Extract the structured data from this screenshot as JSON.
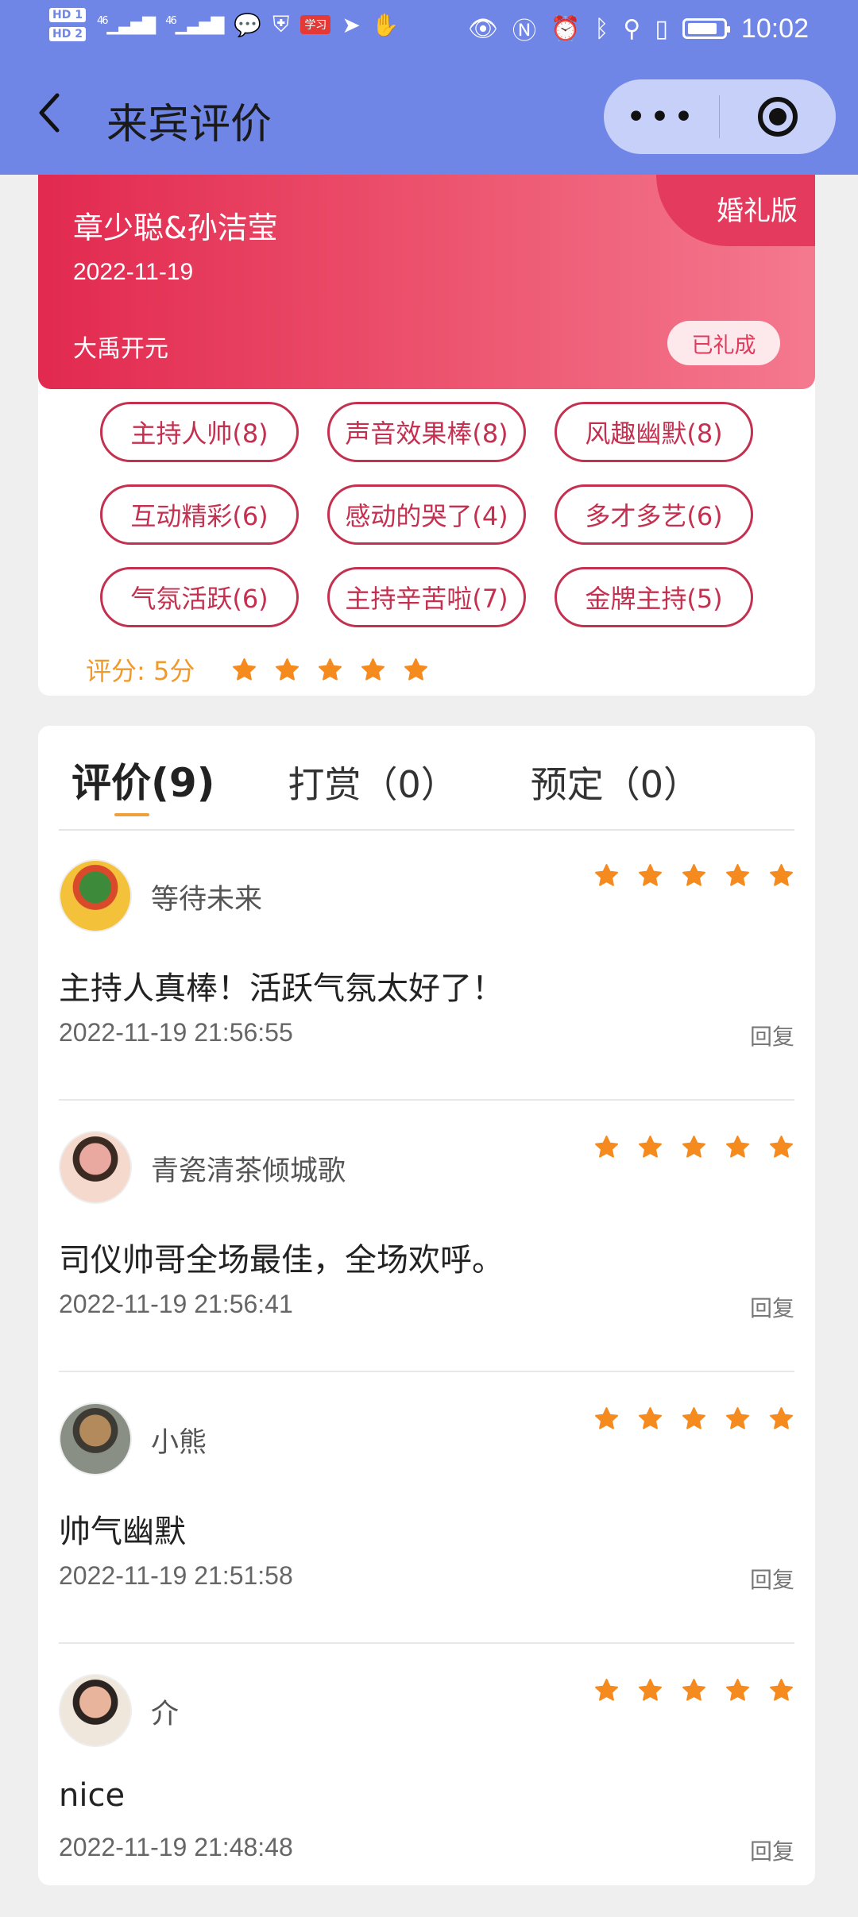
{
  "status_bar": {
    "hd1": "HD 1",
    "hd2": "HD 2",
    "net1": "46",
    "net2": "46",
    "app_badge": "学习",
    "time": "10:02"
  },
  "nav": {
    "title": "来宾评价",
    "more_icon": "•••",
    "back_icon": "chevron-left-icon",
    "target_icon": "target-icon"
  },
  "event": {
    "edition": "婚礼版",
    "names": "章少聪&孙洁莹",
    "date": "2022-11-19",
    "place": "大禹开元",
    "status": "已礼成"
  },
  "tags": [
    "主持人帅(8)",
    "声音效果棒(8)",
    "风趣幽默(8)",
    "互动精彩(6)",
    "感动的哭了(4)",
    "多才多艺(6)",
    "气氛活跃(6)",
    "主持辛苦啦(7)",
    "金牌主持(5)"
  ],
  "score": {
    "label": "评分: 5分",
    "stars": 5
  },
  "tabs": {
    "reviews": "评价(9)",
    "tips": "打赏（0）",
    "bookings": "预定（0）"
  },
  "reviews": [
    {
      "name": "等待未来",
      "stars": 5,
      "text": "主持人真棒！活跃气氛太好了！",
      "time": "2022-11-19 21:56:55",
      "reply": "回复",
      "avatar_colors": [
        "#f3c23a",
        "#d94a2b",
        "#3d8a3a"
      ]
    },
    {
      "name": "青瓷清茶倾城歌",
      "stars": 5,
      "text": "司仪帅哥全场最佳，全场欢呼。",
      "time": "2022-11-19 21:56:41",
      "reply": "回复",
      "avatar_colors": [
        "#f4d9cc",
        "#3a2a22",
        "#e9a9a0"
      ]
    },
    {
      "name": "小熊",
      "stars": 5,
      "text": "帅气幽默",
      "time": "2022-11-19 21:51:58",
      "reply": "回复",
      "avatar_colors": [
        "#8a8f86",
        "#3c3a33",
        "#b28a5c"
      ]
    },
    {
      "name": "介",
      "stars": 5,
      "text": "nice",
      "time": "2022-11-19 21:48:48",
      "reply": "回复",
      "avatar_colors": [
        "#efe6dc",
        "#2b2420",
        "#e8b59c"
      ]
    }
  ],
  "colors": {
    "nav_bg": "#6f86e6",
    "banner_start": "#e2294f",
    "banner_end": "#f4798f",
    "tag_border": "#c4304f",
    "star": "#f58a1f",
    "score_label": "#f09a2a"
  }
}
